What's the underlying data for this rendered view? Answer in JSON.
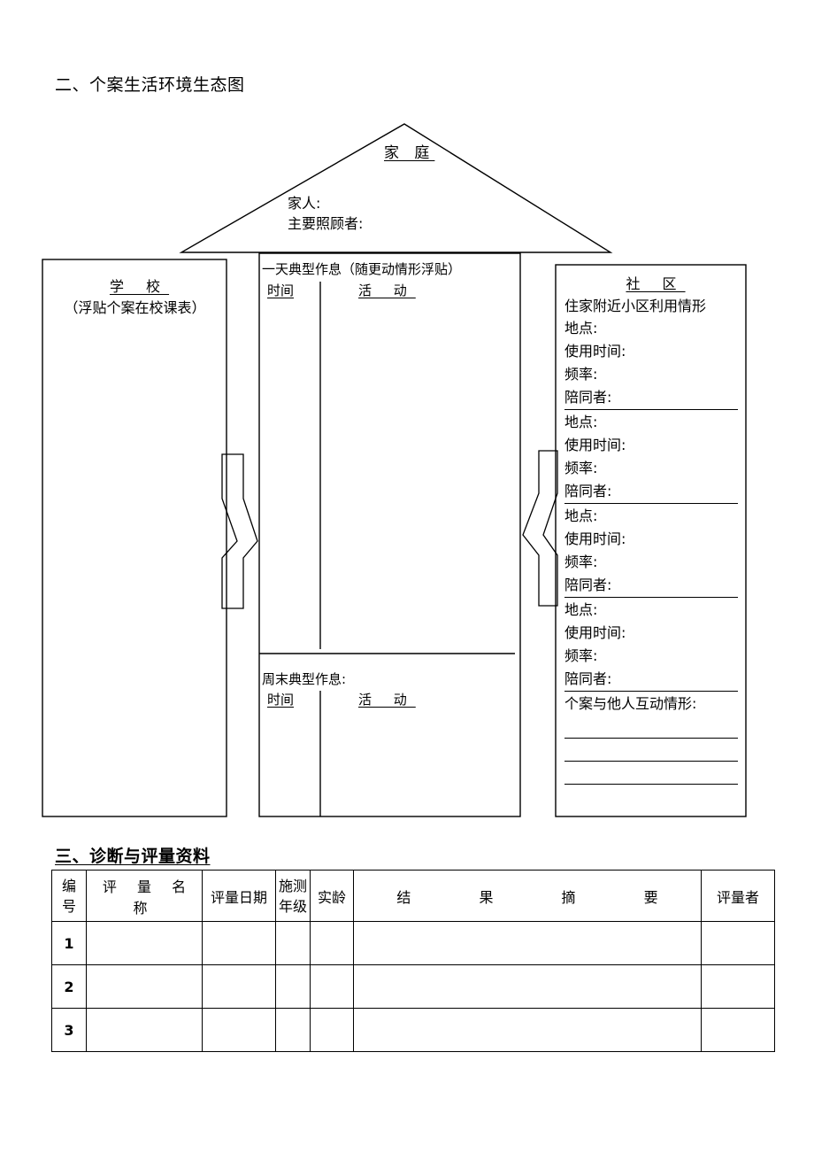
{
  "sections": {
    "two": {
      "heading": "二、个案生活环境生态图"
    },
    "three": {
      "heading": "三、诊断与评量资料"
    }
  },
  "ecomap": {
    "family": {
      "title": "家  庭",
      "members_label": "家人:",
      "caregiver_label": "主要照顾者:"
    },
    "school": {
      "title": "学    校",
      "note": "（浮贴个案在校课表）"
    },
    "middle": {
      "weekday_title": "一天典型作息（随更动情形浮贴）",
      "weekday_time_label": "时间",
      "weekday_activity_label": "活  动",
      "weekend_title": "周末典型作息:",
      "weekend_time_label": "时间",
      "weekend_activity_label": "活  动"
    },
    "community": {
      "title": "社    区",
      "subtitle": "住家附近小区利用情形",
      "entries": [
        {
          "place": "地点:",
          "time": "使用时间:",
          "frequency": "频率:",
          "companion": "陪同者:"
        },
        {
          "place": "地点:",
          "time": "使用时间:",
          "frequency": "频率:",
          "companion": "陪同者:"
        },
        {
          "place": "地点:",
          "time": "使用时间:",
          "frequency": "频率:",
          "companion": "陪同者:"
        },
        {
          "place": "地点:",
          "time": "使用时间:",
          "frequency": "频率:",
          "companion": "陪同者:"
        }
      ],
      "interaction_label": "个案与他人互动情形:",
      "blank_lines": 3
    }
  },
  "assessment_table": {
    "headers": {
      "no_line1": "编",
      "no_line2": "号",
      "name": "评 量 名 称",
      "date": "评量日期",
      "grade_line1": "施测",
      "grade_line2": "年级",
      "age": "实龄",
      "summary": "结   果   摘   要",
      "rater": "评量者"
    },
    "rows": [
      {
        "no": "1",
        "name": "",
        "date": "",
        "grade": "",
        "age": "",
        "summary": "",
        "rater": ""
      },
      {
        "no": "2",
        "name": "",
        "date": "",
        "grade": "",
        "age": "",
        "summary": "",
        "rater": ""
      },
      {
        "no": "3",
        "name": "",
        "date": "",
        "grade": "",
        "age": "",
        "summary": "",
        "rater": ""
      }
    ]
  }
}
